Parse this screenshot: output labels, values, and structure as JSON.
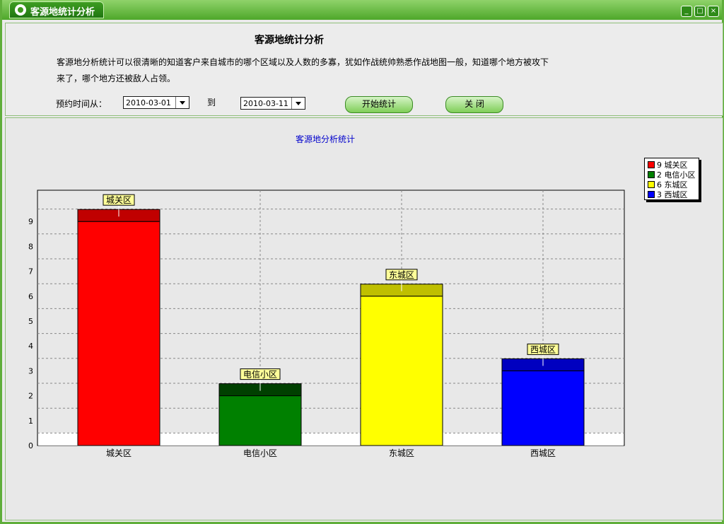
{
  "window": {
    "title": "客源地统计分析",
    "controls": [
      "minimize-icon",
      "restore-icon",
      "close-icon"
    ]
  },
  "header": {
    "heading": "客源地统计分析",
    "description": "客源地分析统计可以很清晰的知道客户来自城市的哪个区域以及人数的多寡，犹如作战统帅熟悉作战地图一般，知道哪个地方被攻下来了，哪个地方还被敌人占领。"
  },
  "filters": {
    "from_label": "预约时间从：",
    "from_value": "2010-03-01",
    "to_label": "到",
    "to_value": "2010-03-11",
    "start_button": "开始统计",
    "close_button": "关 闭"
  },
  "colors": {
    "title_green": "#4ea72a",
    "chart_title": "#0000cc"
  },
  "chart_data": {
    "type": "bar",
    "title": "客源地分析统计",
    "categories": [
      "城关区",
      "电信小区",
      "东城区",
      "西城区"
    ],
    "values": [
      9,
      2,
      6,
      3
    ],
    "colors": [
      "#ff0000",
      "#008000",
      "#ffff00",
      "#0000ff"
    ],
    "top_colors": [
      "#c00000",
      "#004000",
      "#bfbf00",
      "#0000c0"
    ],
    "y_ticks": [
      0,
      1,
      2,
      3,
      4,
      5,
      6,
      7,
      8,
      9
    ],
    "ylim": [
      0,
      10
    ],
    "grid": true,
    "legend_position": "top-right",
    "legend": [
      "9 城关区",
      "2 电信小区",
      "6 东城区",
      "3 西城区"
    ]
  }
}
